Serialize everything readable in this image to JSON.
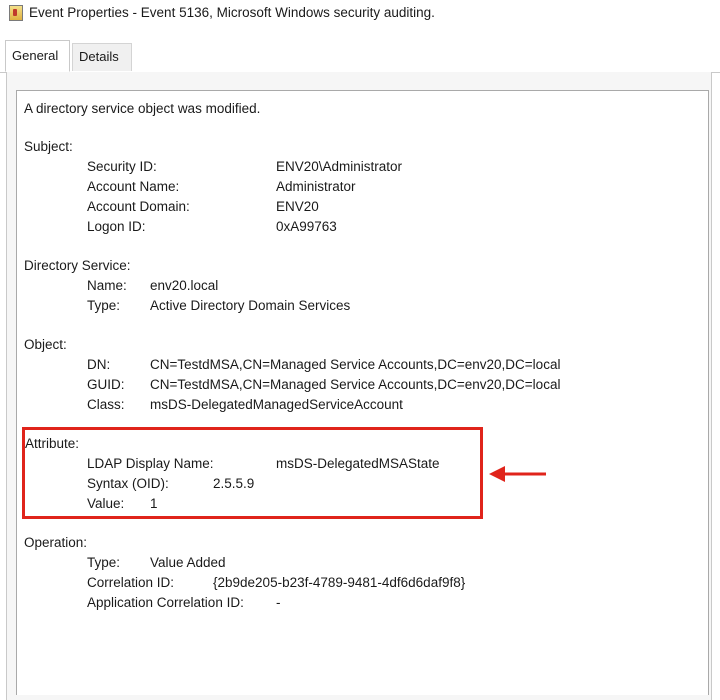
{
  "window": {
    "title": "Event Properties - Event 5136, Microsoft Windows security auditing."
  },
  "tabs": [
    {
      "label": "General",
      "active": true
    },
    {
      "label": "Details",
      "active": false
    }
  ],
  "event": {
    "headline": "A directory service object was modified.",
    "subject": {
      "heading": "Subject:",
      "rows": [
        {
          "label": "Security ID:",
          "value": "ENV20\\Administrator"
        },
        {
          "label": "Account Name:",
          "value": "Administrator"
        },
        {
          "label": "Account Domain:",
          "value": "ENV20"
        },
        {
          "label": "Logon ID:",
          "value": "0xA99763"
        }
      ]
    },
    "directory_service": {
      "heading": "Directory Service:",
      "rows": [
        {
          "label": "Name:",
          "value": "env20.local"
        },
        {
          "label": "Type:",
          "value": "Active Directory Domain Services"
        }
      ]
    },
    "object": {
      "heading": "Object:",
      "rows": [
        {
          "label": "DN:",
          "value": "CN=TestdMSA,CN=Managed Service Accounts,DC=env20,DC=local"
        },
        {
          "label": "GUID:",
          "value": "CN=TestdMSA,CN=Managed Service Accounts,DC=env20,DC=local"
        },
        {
          "label": "Class:",
          "value": "msDS-DelegatedManagedServiceAccount"
        }
      ]
    },
    "attribute": {
      "heading": "Attribute:",
      "rows": [
        {
          "label": "LDAP Display Name:",
          "value": "msDS-DelegatedMSAState"
        },
        {
          "label": "Syntax (OID):",
          "value": "2.5.5.9"
        },
        {
          "label": "Value:",
          "value": "1"
        }
      ]
    },
    "operation": {
      "heading": "Operation:",
      "rows": [
        {
          "label": "Type:",
          "value": "Value Added"
        },
        {
          "label": "Correlation ID:",
          "value": "{2b9de205-b23f-4789-9481-4df6d6daf9f8}"
        },
        {
          "label": "Application Correlation ID:",
          "value": "-"
        }
      ]
    }
  },
  "annotation": {
    "highlight_color": "#e0241b"
  }
}
